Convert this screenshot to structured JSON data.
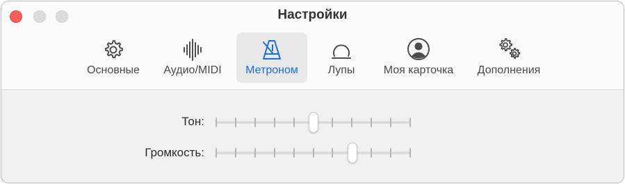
{
  "window": {
    "title": "Настройки"
  },
  "toolbar": {
    "tabs": [
      {
        "label": "Основные",
        "icon": "gear-icon"
      },
      {
        "label": "Аудио/MIDI",
        "icon": "waveform-icon"
      },
      {
        "label": "Метроном",
        "icon": "metronome-icon",
        "selected": true
      },
      {
        "label": "Лупы",
        "icon": "loop-icon"
      },
      {
        "label": "Моя карточка",
        "icon": "person-circle-icon"
      },
      {
        "label": "Дополнения",
        "icon": "gears-icon"
      }
    ]
  },
  "settings": {
    "tone": {
      "label": "Тон:",
      "ticks": 11,
      "value_fraction": 0.5
    },
    "volume": {
      "label": "Громкость:",
      "ticks": 11,
      "value_fraction": 0.7
    }
  },
  "colors": {
    "accent": "#1a6ee0",
    "close": "#ff5f57",
    "inactive_button": "#dcdcdc"
  }
}
